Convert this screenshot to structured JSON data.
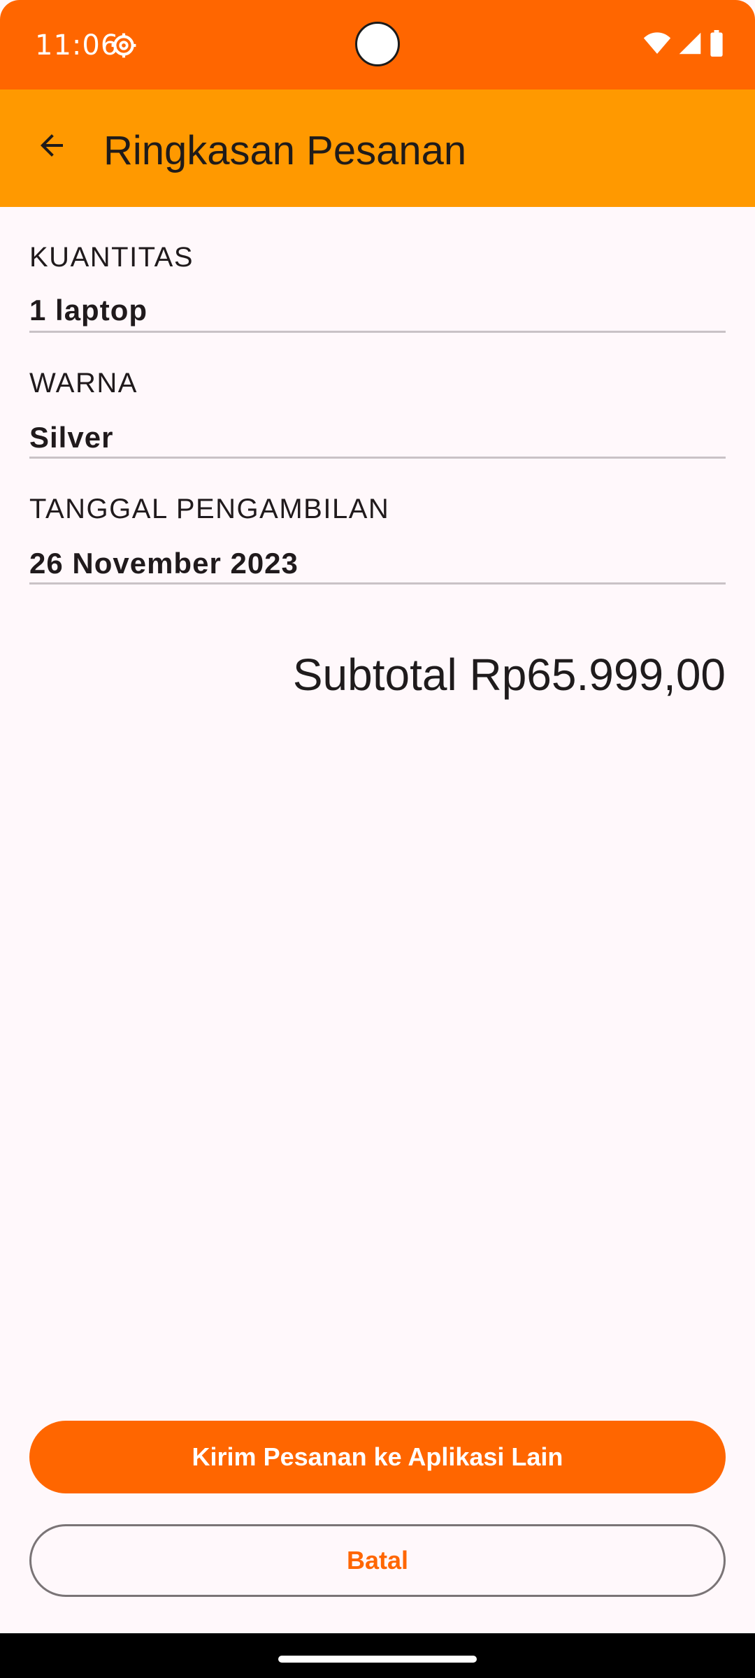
{
  "status_bar": {
    "time": "11:06",
    "icons": [
      "settings-gear-icon",
      "wifi-icon",
      "cell-signal-icon",
      "battery-icon"
    ],
    "color": "#FF6600"
  },
  "app_bar": {
    "title": "Ringkasan Pesanan",
    "back_icon": "arrow-back-icon",
    "color": "#FF9900"
  },
  "summary": {
    "fields": [
      {
        "label": "KUANTITAS",
        "value": "1 laptop"
      },
      {
        "label": "WARNA",
        "value": "Silver"
      },
      {
        "label": "TANGGAL PENGAMBILAN",
        "value": "26 November 2023"
      }
    ],
    "subtotal": "Subtotal Rp65.999,00"
  },
  "actions": {
    "send_label": "Kirim Pesanan ke Aplikasi Lain",
    "cancel_label": "Batal",
    "accent": "#FF6600"
  }
}
